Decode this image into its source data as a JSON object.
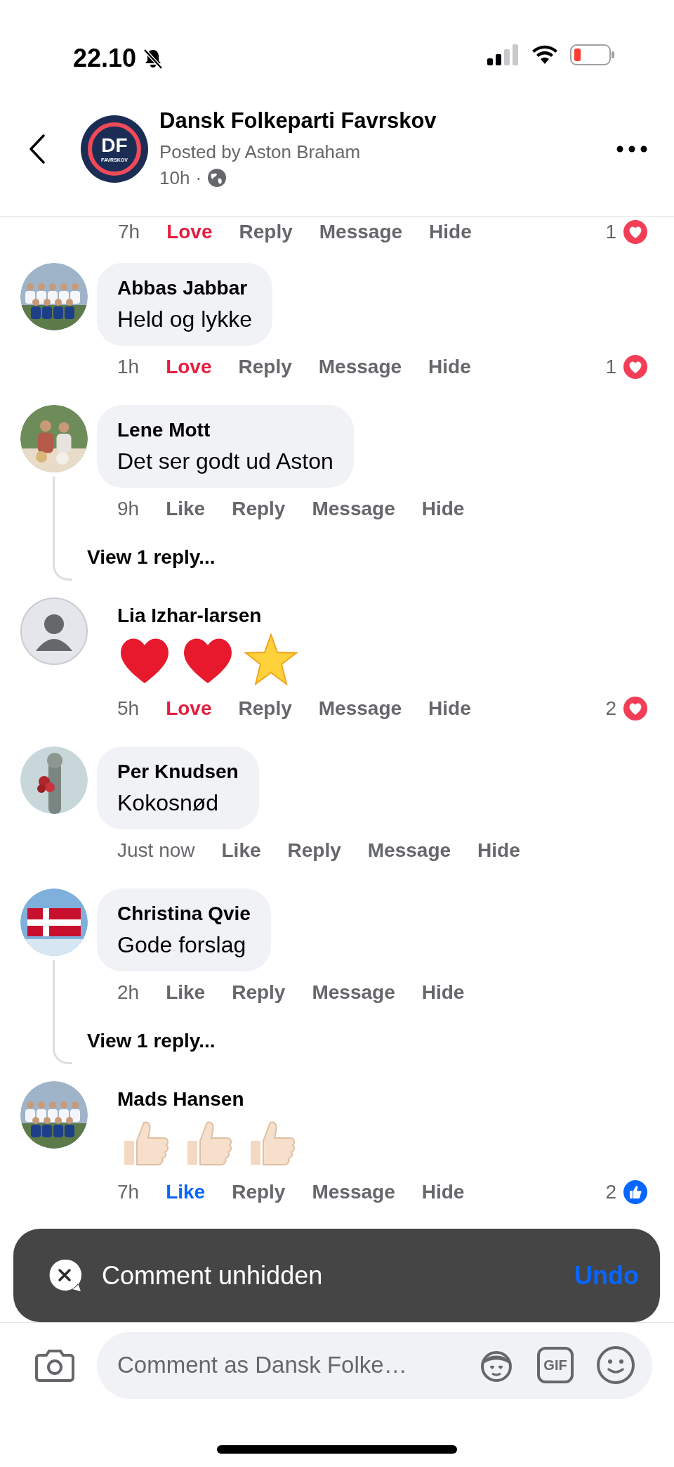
{
  "status_bar": {
    "time": "22.10",
    "silent": true
  },
  "header": {
    "logo": {
      "initials": "DF",
      "caption": "FAVRSKOV"
    },
    "title": "Dansk Folkeparti Favrskov",
    "subtitle": "Posted by Aston Braham",
    "time": "10h",
    "separator": "·"
  },
  "partial_row": {
    "time": "7h",
    "reaction_button": {
      "label": "Love",
      "kind": "love"
    },
    "actions": [
      "Reply",
      "Message",
      "Hide"
    ],
    "reactions": {
      "count": "1",
      "kind": "love"
    }
  },
  "comments": [
    {
      "kind": "text",
      "author": "Abbas Jabbar",
      "text": "Held og lykke",
      "time": "1h",
      "reaction_button": {
        "label": "Love",
        "kind": "love"
      },
      "actions": [
        "Reply",
        "Message",
        "Hide"
      ],
      "reactions": {
        "count": "1",
        "kind": "love"
      }
    },
    {
      "kind": "text",
      "author": "Lene Mott",
      "text": "Det ser godt ud Aston",
      "time": "9h",
      "reaction_button": {
        "label": "Like",
        "kind": "none"
      },
      "actions": [
        "Reply",
        "Message",
        "Hide"
      ],
      "replies": "View 1 reply..."
    },
    {
      "kind": "emoji",
      "avatar": {
        "kind": "default"
      },
      "author": "Lia Izhar-larsen",
      "emoji": [
        {
          "kind": "heart"
        },
        {
          "kind": "heart"
        },
        {
          "kind": "star"
        }
      ],
      "time": "5h",
      "reaction_button": {
        "label": "Love",
        "kind": "love"
      },
      "actions": [
        "Reply",
        "Message",
        "Hide"
      ],
      "reactions": {
        "count": "2",
        "kind": "love"
      }
    },
    {
      "kind": "text",
      "author": "Per Knudsen",
      "text": "Kokosnød",
      "time": "Just now",
      "reaction_button": {
        "label": "Like",
        "kind": "none"
      },
      "actions": [
        "Reply",
        "Message",
        "Hide"
      ]
    },
    {
      "kind": "text",
      "author": "Christina Qvie",
      "text": "Gode forslag",
      "time": "2h",
      "reaction_button": {
        "label": "Like",
        "kind": "none"
      },
      "actions": [
        "Reply",
        "Message",
        "Hide"
      ],
      "replies": "View 1 reply..."
    },
    {
      "kind": "emoji",
      "author": "Mads Hansen",
      "emoji": [
        {
          "kind": "thumbs_up"
        },
        {
          "kind": "thumbs_up"
        },
        {
          "kind": "thumbs_up"
        }
      ],
      "time": "7h",
      "reaction_button": {
        "label": "Like",
        "kind": "like"
      },
      "actions": [
        "Reply",
        "Message",
        "Hide"
      ],
      "reactions": {
        "count": "2",
        "kind": "like"
      }
    }
  ],
  "snackbar": {
    "message": "Comment unhidden",
    "action": "Undo"
  },
  "composer": {
    "placeholder": "Comment as Dansk Folke…",
    "gif_label": "GIF"
  }
}
